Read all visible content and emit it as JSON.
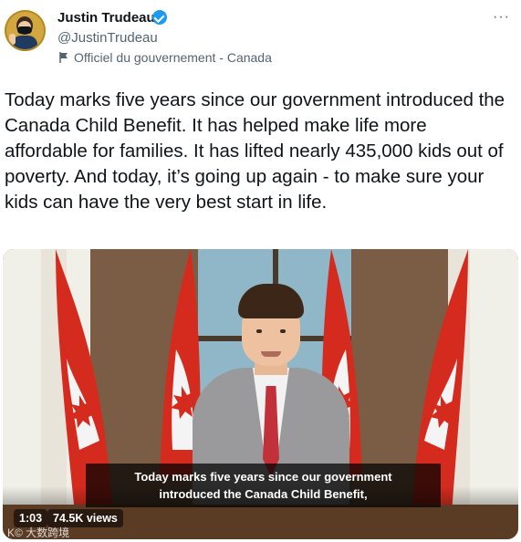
{
  "header": {
    "name": "Justin Trudeau",
    "handle": "@JustinTrudeau",
    "affiliation": "Officiel du gouvernement - Canada",
    "more_label": "···"
  },
  "tweet": {
    "text": "Today marks five years since our government introduced the Canada Child Benefit. It has helped make life more affordable for families. It has lifted nearly 435,000 kids out of poverty. And today, it’s going up again - to make sure your kids can have the very best start in life."
  },
  "video": {
    "caption_line1": "Today marks five years since our government",
    "caption_line2": "introduced the Canada Child Benefit,",
    "timecode": "1:03",
    "views": "74.5K views",
    "watermark": "K© 大数跨境"
  },
  "colors": {
    "verified": "#1d9bf0",
    "text_secondary": "#536471",
    "flag_red": "#d52b1e"
  }
}
